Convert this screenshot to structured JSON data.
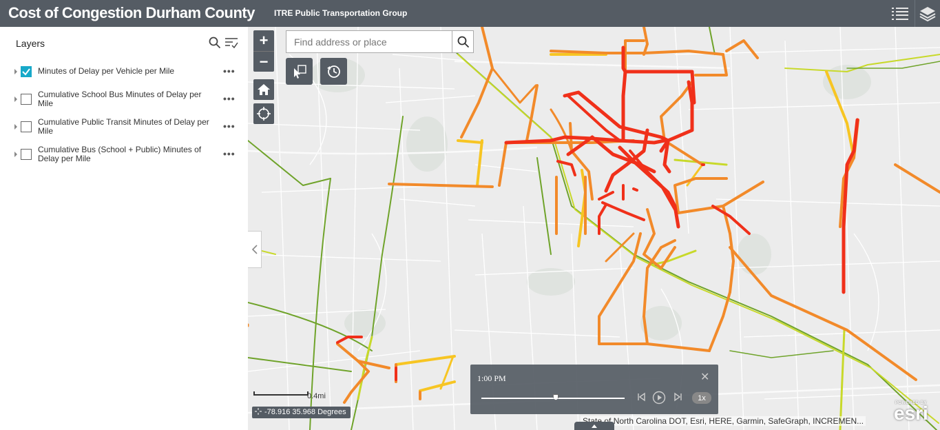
{
  "header": {
    "title": "Cost of Congestion Durham County",
    "subtitle": "ITRE Public Transportation Group",
    "list_icon": "list-icon",
    "layers_icon": "layers-stack-icon"
  },
  "layers_panel": {
    "title": "Layers",
    "items": [
      {
        "label": "Minutes of Delay per Vehicle per Mile",
        "checked": true
      },
      {
        "label": "Cumulative School Bus Minutes of Delay per Mile",
        "checked": false
      },
      {
        "label": "Cumulative Public Transit Minutes of Delay per Mile",
        "checked": false
      },
      {
        "label": "Cumulative Bus (School + Public) Minutes of Delay per Mile",
        "checked": false
      }
    ],
    "more_label": "•••"
  },
  "map": {
    "zoom_in": "+",
    "zoom_out": "−",
    "search": {
      "placeholder": "Find address or place",
      "value": ""
    },
    "scale_label": "0.4mi",
    "coordinates": "-78.916 35.968 Degrees",
    "attribution": "State of North Carolina DOT, Esri, HERE, Garmin, SafeGraph, INCREMEN...",
    "esri_powered": "POWERED BY",
    "esri_brand": "esri",
    "colors": {
      "severe": "#f0301a",
      "high": "#f28a2a",
      "medium": "#f7c523",
      "low": "#c8d92a",
      "minimal": "#6fa32a",
      "accent": "#18a9c9"
    }
  },
  "time_slider": {
    "time": "1:00 PM",
    "close": "✕",
    "speed": "1x",
    "progress": 0.52
  }
}
